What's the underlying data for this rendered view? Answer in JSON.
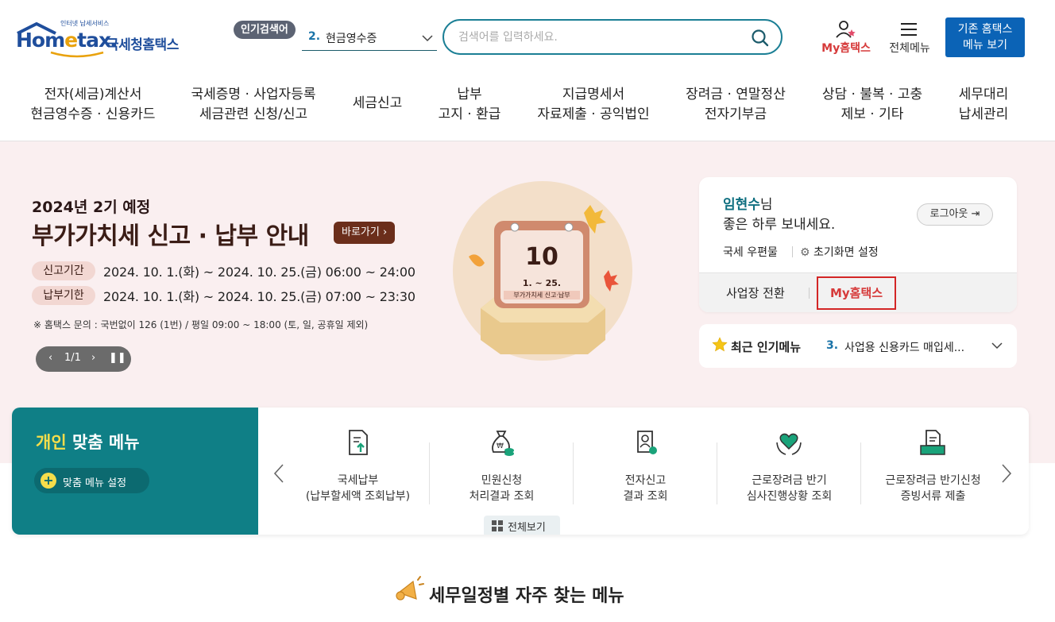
{
  "header": {
    "logo_small": "인터넷 납세서비스",
    "logo_brand_a": "Hom",
    "logo_brand_e": "e",
    "logo_brand_b": "tax.",
    "logo_kor": "국세청홈택스",
    "popular_badge": "인기검색어",
    "popular_num": "2.",
    "popular_text": "현금영수증",
    "search_placeholder": "검색어를 입력하세요.",
    "my_hometax": "My홈택스",
    "all_menu": "전체메뉴",
    "legacy_line1": "기존 홈택스",
    "legacy_line2": "메뉴 보기"
  },
  "nav": [
    {
      "l1": "전자(세금)계산서",
      "l2": "현금영수증 · 신용카드"
    },
    {
      "l1": "국세증명 · 사업자등록",
      "l2": "세금관련 신청/신고"
    },
    {
      "l1": "세금신고",
      "l2": ""
    },
    {
      "l1": "납부",
      "l2": "고지 · 환급"
    },
    {
      "l1": "지급명세서",
      "l2": "자료제출 · 공익법인"
    },
    {
      "l1": "장려금 · 연말정산",
      "l2": "전자기부금"
    },
    {
      "l1": "상담 · 불복 · 고충",
      "l2": "제보 · 기타"
    },
    {
      "l1": "세무대리",
      "l2": "납세관리"
    }
  ],
  "hero": {
    "year": "2024년 2기 예정",
    "title": "부가가치세 신고 · 납부 안내",
    "go": "바로가기",
    "tag1": "신고기간",
    "val1": "2024. 10. 1.(화) ~ 2024. 10. 25.(금)  06:00 ~ 24:00",
    "tag2": "납부기한",
    "val2": "2024. 10. 1.(화) ~ 2024. 10. 25.(금)  07:00 ~ 23:30",
    "notice": "※ 홈택스 문의 : 국번없이 126 (1번) / 평일 09:00 ~ 18:00 (토, 일, 공휴일 제외)",
    "pager": "1/1",
    "cal_num": "10",
    "cal_range": "1. ~ 25.",
    "cal_label": "부가가치세 신고·납부"
  },
  "user": {
    "name": "임현수",
    "suffix": "님",
    "greeting": "좋은 하루 보내세요.",
    "logout": "로그아웃",
    "mail": "국세 우편물",
    "init": "초기화면 설정",
    "switch": "사업장 전환",
    "my": "My홈택스"
  },
  "recent": {
    "label": "최근 인기메뉴",
    "num": "3.",
    "text": "사업용 신용카드 매입세..."
  },
  "custom": {
    "title_hl": "개인",
    "title_rest": "맞춤 메뉴",
    "set_btn": "맞춤 메뉴 설정",
    "items": [
      {
        "l1": "국세납부",
        "l2": "(납부할세액 조회납부)"
      },
      {
        "l1": "민원신청",
        "l2": "처리결과 조회"
      },
      {
        "l1": "전자신고",
        "l2": "결과 조회"
      },
      {
        "l1": "근로장려금 반기",
        "l2": "심사진행상황 조회"
      },
      {
        "l1": "근로장려금 반기신청",
        "l2": "증빙서류 제출"
      }
    ],
    "all_view": "전체보기"
  },
  "frequent": {
    "title": "세무일정별 자주 찾는 메뉴"
  },
  "colors": {
    "brand_blue": "#1f4e9c",
    "teal": "#0f7f86",
    "hero_bg": "#faeff0",
    "highlight_red": "#d32626"
  }
}
